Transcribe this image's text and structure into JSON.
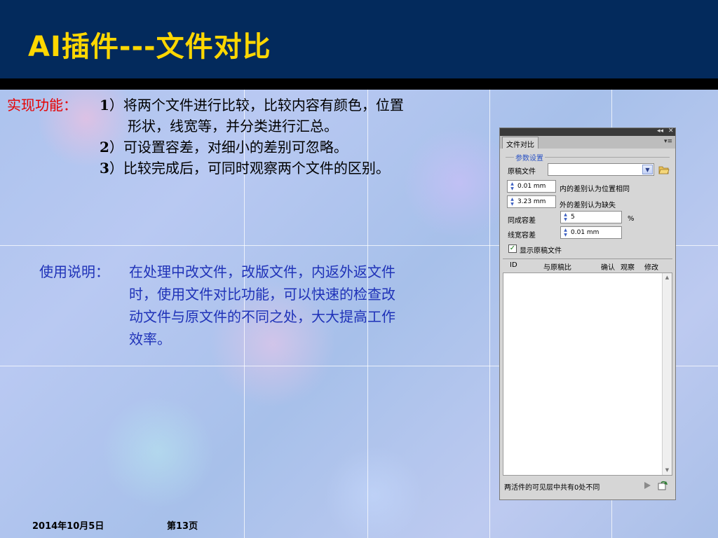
{
  "slide": {
    "title": "AI插件---文件对比",
    "features": {
      "label": "实现功能：",
      "items": [
        {
          "num": "1",
          "lines": [
            "）将两个文件进行比较，比较内容有颜色，位置",
            "形状，线宽等，并分类进行汇总。"
          ]
        },
        {
          "num": "2",
          "lines": [
            "）可设置容差，对细小的差别可忽略。"
          ]
        },
        {
          "num": "3",
          "lines": [
            "）比较完成后，可同时观察两个文件的区别。"
          ]
        }
      ]
    },
    "usage": {
      "label": "使用说明：",
      "lines": [
        "在处理中改文件，改版文件，内返外返文件",
        "时，使用文件对比功能，可以快速的检查改",
        "动文件与原文件的不同之处，大大提高工作",
        "效率。"
      ]
    },
    "footer": {
      "date": "2014年10月5日",
      "page": "第13页"
    },
    "colors": {
      "header_bg": "#032a5c",
      "title": "#ffd700",
      "features_label": "#e60000",
      "usage_text": "#1f32b8"
    }
  },
  "panel": {
    "tab_label": "文件对比",
    "topbar_controls": [
      "◂◂",
      "✕"
    ],
    "menu_icon": "panel-menu-icon",
    "group_label": "参数设置",
    "original_file_label": "原稿文件",
    "original_file_value": "",
    "inner_tolerance_value": "0.01 mm",
    "inner_tolerance_desc": "内的差别认为位置相同",
    "outer_tolerance_value": "3.23 mm",
    "outer_tolerance_desc": "外的差别认为缺失",
    "color_tolerance_label": "同成容差",
    "color_tolerance_value": "5",
    "color_tolerance_unit": "%",
    "stroke_tolerance_label": "线宽容差",
    "stroke_tolerance_value": "0.01 mm",
    "show_original_label": "显示原稿文件",
    "show_original_checked": true,
    "list_columns": [
      "ID",
      "与原稿比",
      "确认",
      "观察",
      "修改"
    ],
    "status_text": "两活件的可见层中共有0处不同"
  }
}
